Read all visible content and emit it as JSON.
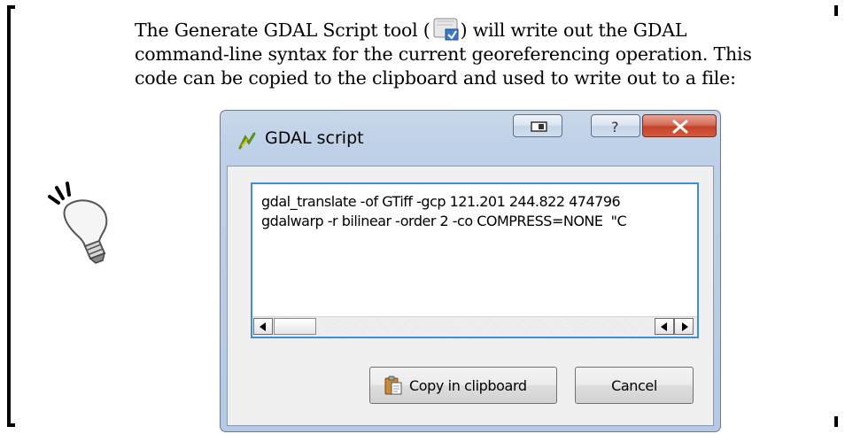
{
  "paragraph": {
    "before_icon": "The Generate GDAL Script tool (",
    "after_icon": ") will write out the GDAL",
    "line2": "command-line syntax for the current georeferencing operation. This",
    "line3": "code can be copied to the clipboard and used to write out to a file:"
  },
  "dialog": {
    "title": "GDAL script",
    "code_lines": [
      "gdal_translate -of GTiff -gcp 121.201 244.822 474796",
      "gdalwarp -r bilinear -order 2 -co COMPRESS=NONE  \"C"
    ],
    "copy_button": "Copy in clipboard",
    "cancel_button": "Cancel"
  },
  "icons": {
    "tip": "lightbulb-icon",
    "tool": "generate-script-icon",
    "title": "qgis-icon",
    "clipboard": "clipboard-icon"
  }
}
